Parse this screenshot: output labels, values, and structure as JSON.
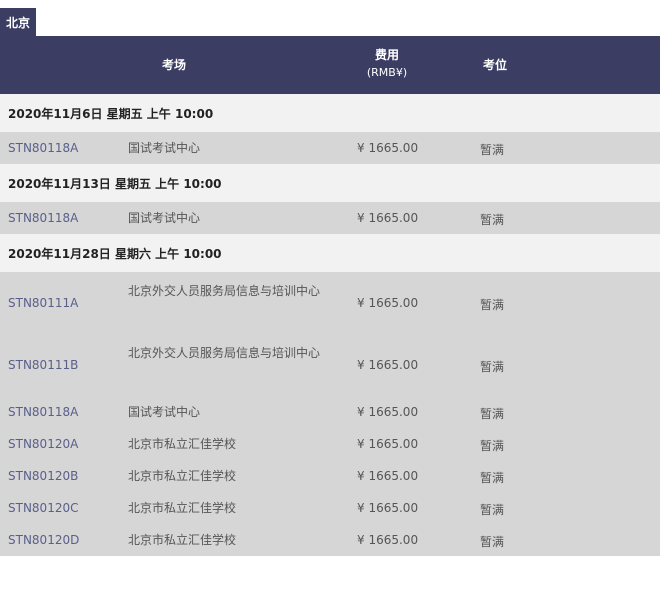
{
  "city_tab": "北京",
  "header": {
    "venue": "考场",
    "fee_label": "费用",
    "fee_unit": "(RMB¥)",
    "seat": "考位"
  },
  "groups": [
    {
      "date": "2020年11月6日 星期五 上午 10:00",
      "rows": [
        {
          "code": "STN80118A",
          "venue": "国试考试中心",
          "fee": "¥ 1665.00",
          "seat": "暂满"
        }
      ]
    },
    {
      "date": "2020年11月13日 星期五 上午 10:00",
      "rows": [
        {
          "code": "STN80118A",
          "venue": "国试考试中心",
          "fee": "¥ 1665.00",
          "seat": "暂满"
        }
      ]
    },
    {
      "date": "2020年11月28日 星期六 上午 10:00",
      "rows": [
        {
          "code": "STN80111A",
          "venue": "北京外交人员服务局信息与培训中心",
          "fee": "¥ 1665.00",
          "seat": "暂满"
        },
        {
          "code": "STN80111B",
          "venue": "北京外交人员服务局信息与培训中心",
          "fee": "¥ 1665.00",
          "seat": "暂满"
        },
        {
          "code": "STN80118A",
          "venue": "国试考试中心",
          "fee": "¥ 1665.00",
          "seat": "暂满"
        },
        {
          "code": "STN80120A",
          "venue": "北京市私立汇佳学校",
          "fee": "¥ 1665.00",
          "seat": "暂满"
        },
        {
          "code": "STN80120B",
          "venue": "北京市私立汇佳学校",
          "fee": "¥ 1665.00",
          "seat": "暂满"
        },
        {
          "code": "STN80120C",
          "venue": "北京市私立汇佳学校",
          "fee": "¥ 1665.00",
          "seat": "暂满"
        },
        {
          "code": "STN80120D",
          "venue": "北京市私立汇佳学校",
          "fee": "¥ 1665.00",
          "seat": "暂满"
        }
      ]
    }
  ]
}
